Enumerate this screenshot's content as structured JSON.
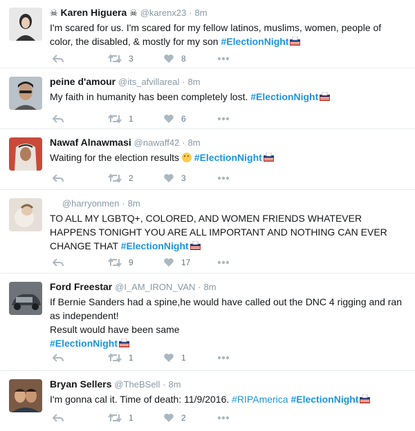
{
  "tweets": [
    {
      "name": "Karen Higuera",
      "name_decor": "☠",
      "handle": "@karenx23",
      "time": "8m",
      "text": "I'm scared for us. I'm scared for my fellow latinos, muslims, women, people of color, the disabled, & mostly for my son",
      "hashtag": "#ElectionNight",
      "reply_icon": "reply-icon",
      "retweets": "3",
      "likes": "8"
    },
    {
      "name": "peine d'amour",
      "handle": "@its_afvillareal",
      "time": "8m",
      "text": "My faith in humanity has been completely lost.",
      "hashtag": "#ElectionNight",
      "retweets": "1",
      "likes": "6"
    },
    {
      "name": "Nawaf Alnawmasi",
      "handle": "@nawaff42",
      "time": "8m",
      "text": "Waiting for the election results",
      "hashtag": "#ElectionNight",
      "retweets": "2",
      "likes": "3"
    },
    {
      "name": "",
      "handle": "@harryonmen",
      "time": "8m",
      "text": "TO ALL MY LGBTQ+, COLORED, AND WOMEN FRIENDS WHATEVER HAPPENS TONIGHT YOU ARE ALL IMPORTANT AND NOTHING CAN EVER CHANGE THAT",
      "hashtag": "#ElectionNight",
      "retweets": "9",
      "likes": "17"
    },
    {
      "name": "Ford Freestar",
      "handle": "@I_AM_IRON_VAN",
      "time": "8m",
      "text": "If Bernie Sanders had a spine,he would have called out the DNC 4 rigging and ran as independent!",
      "text2": "Result would have been same",
      "hashtag": "#ElectionNight",
      "retweets": "1",
      "likes": "1"
    },
    {
      "name": "Bryan Sellers",
      "handle": "@TheBSell",
      "time": "8m",
      "text": "I'm gonna cal it. Time of death: 11/9/2016.",
      "hashtag_pre": "#RIPAmerica",
      "hashtag": "#ElectionNight",
      "retweets": "1",
      "likes": "2"
    }
  ],
  "separator": "·",
  "colors": {
    "hashtag": "#1b95e0",
    "meta": "#8899a6",
    "action": "#aab8c2"
  }
}
